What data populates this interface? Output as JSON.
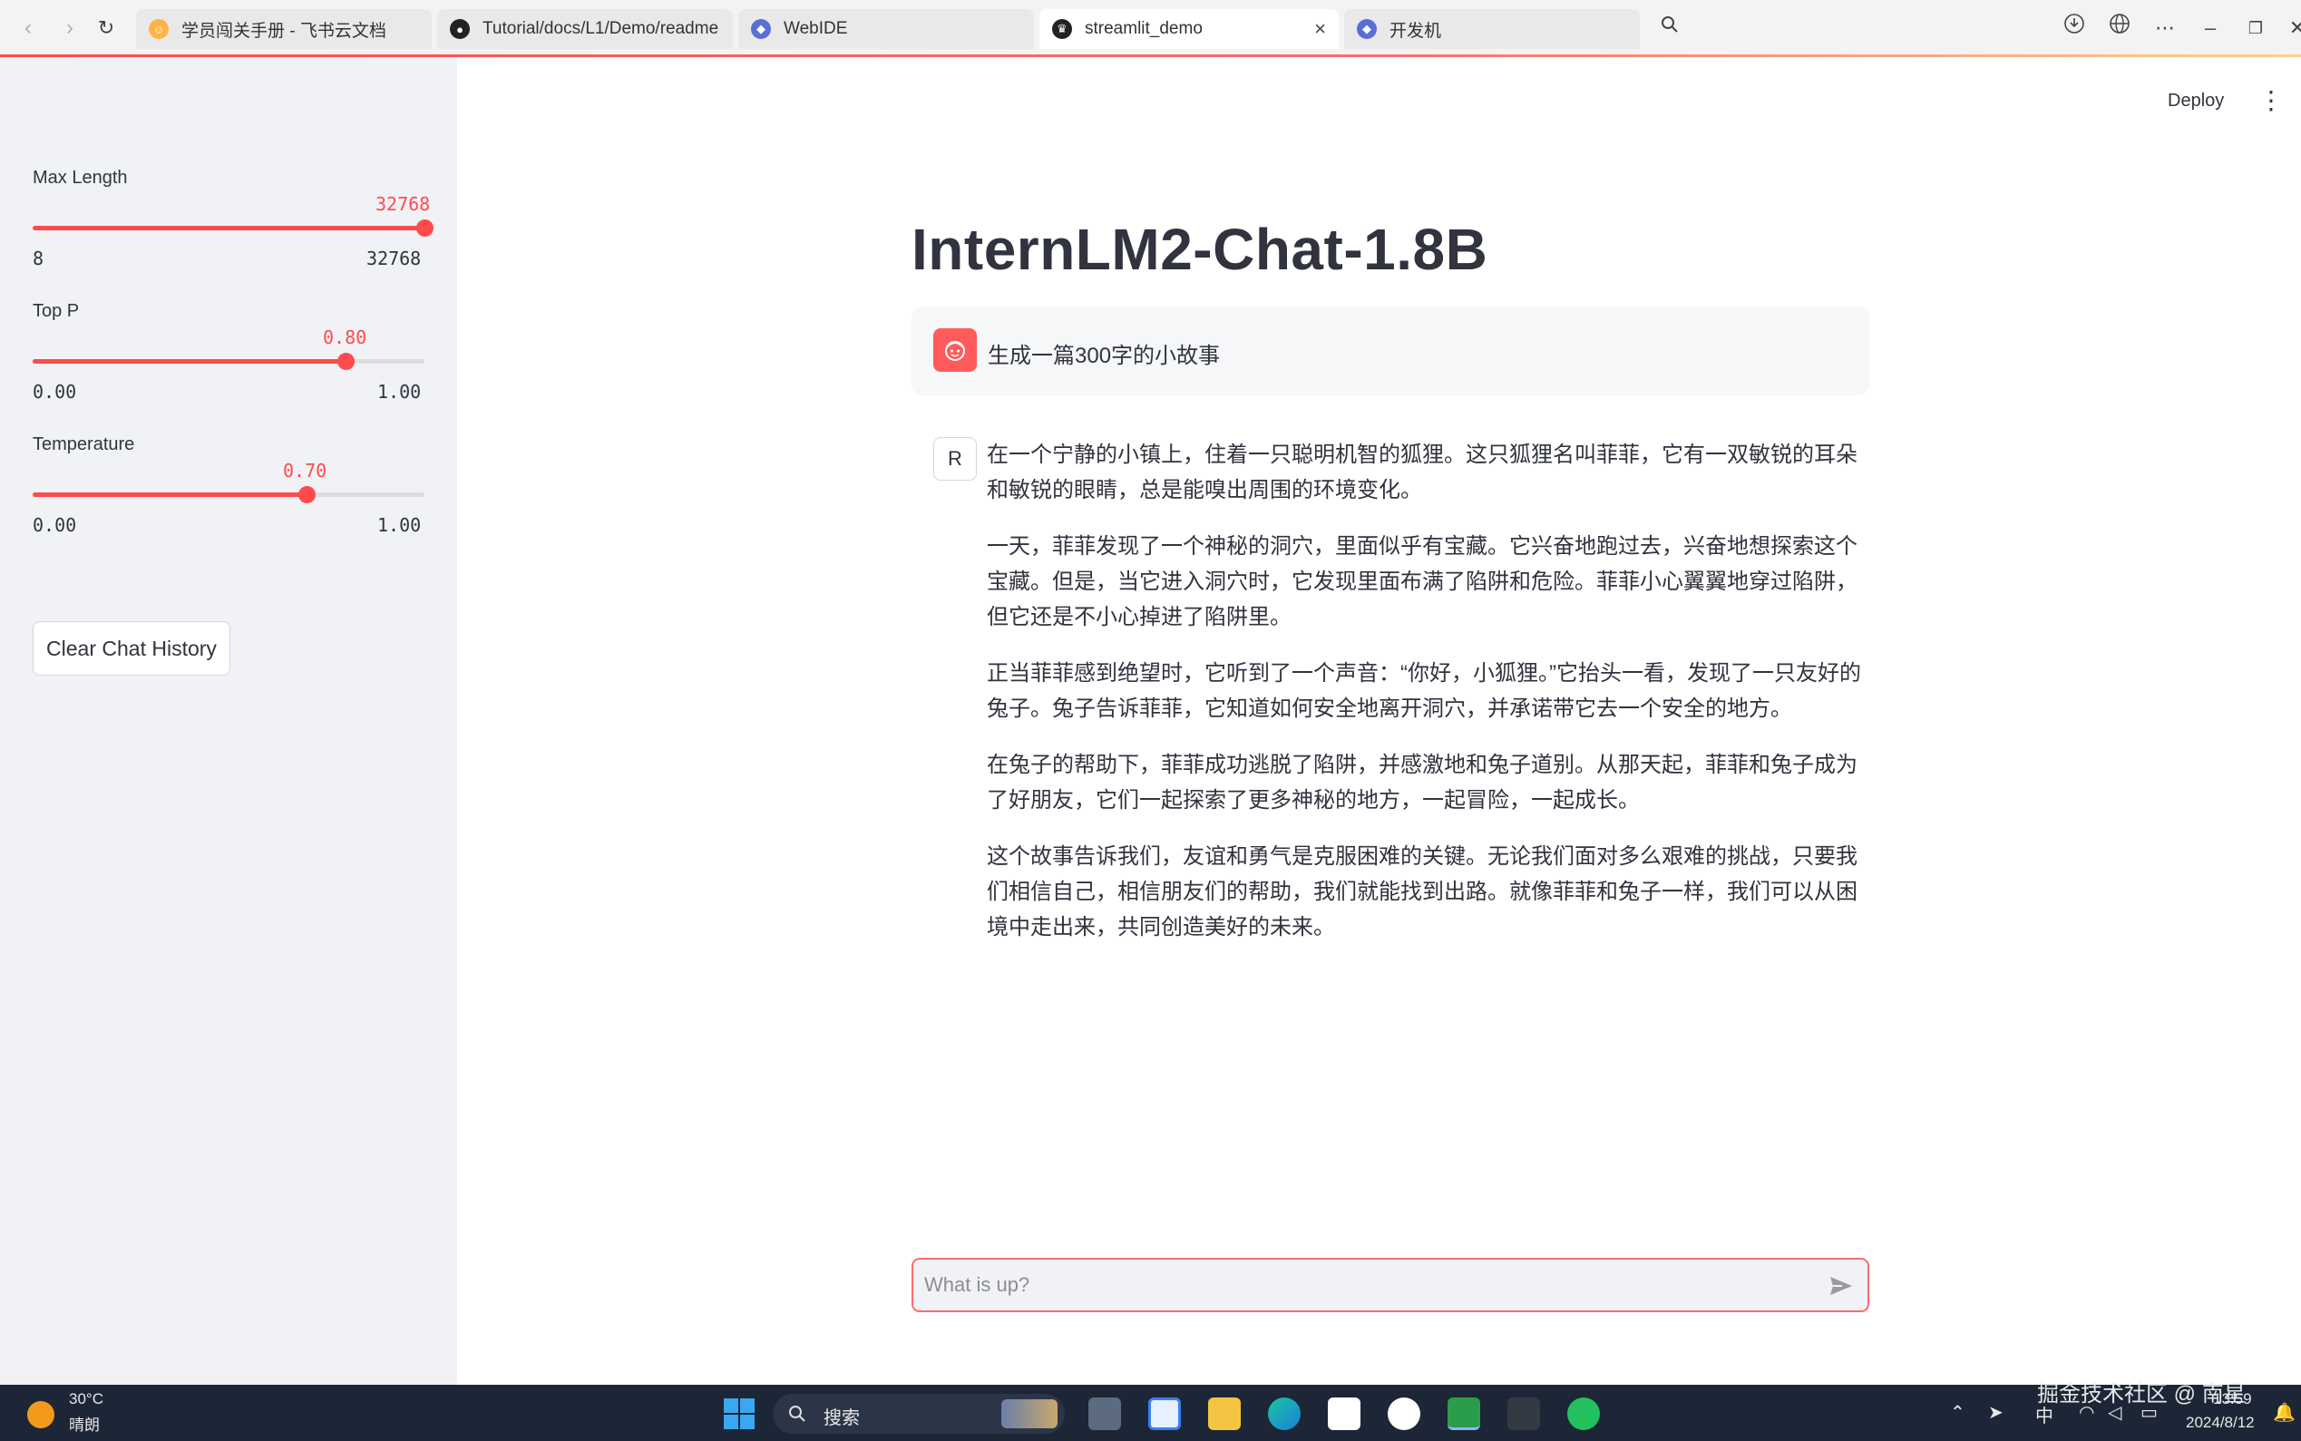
{
  "browser": {
    "tabs": [
      {
        "label": "学员闯关手册 - 飞书云文档",
        "active": false
      },
      {
        "label": "Tutorial/docs/L1/Demo/readme",
        "active": false
      },
      {
        "label": "WebIDE",
        "active": false
      },
      {
        "label": "streamlit_demo",
        "active": true
      },
      {
        "label": "开发机",
        "active": false
      }
    ],
    "back_icon": "back-arrow-icon",
    "forward_icon": "forward-arrow-icon",
    "reload_icon": "reload-icon",
    "close_icon": "×"
  },
  "sidebar": {
    "max_length": {
      "label": "Max Length",
      "value": "32768",
      "min": "8",
      "max": "32768",
      "fraction": 1.0
    },
    "top_p": {
      "label": "Top P",
      "value": "0.80",
      "min": "0.00",
      "max": "1.00",
      "fraction": 0.8
    },
    "temperature": {
      "label": "Temperature",
      "value": "0.70",
      "min": "0.00",
      "max": "1.00",
      "fraction": 0.7
    },
    "clear_button": "Clear Chat History",
    "accent_color": "#ff4b4b"
  },
  "header": {
    "deploy": "Deploy",
    "menu_icon": "⋮"
  },
  "main": {
    "title": "InternLM2-Chat-1.8B",
    "user_avatar": "R",
    "user_message": "生成一篇300字的小故事",
    "assistant_paragraphs": [
      "在一个宁静的小镇上，住着一只聪明机智的狐狸。这只狐狸名叫菲菲，它有一双敏锐的耳朵和敏锐的眼睛，总是能嗅出周围的环境变化。",
      "一天，菲菲发现了一个神秘的洞穴，里面似乎有宝藏。它兴奋地跑过去，兴奋地想探索这个宝藏。但是，当它进入洞穴时，它发现里面布满了陷阱和危险。菲菲小心翼翼地穿过陷阱，但它还是不小心掉进了陷阱里。",
      "正当菲菲感到绝望时，它听到了一个声音：“你好，小狐狸。”它抬头一看，发现了一只友好的兔子。兔子告诉菲菲，它知道如何安全地离开洞穴，并承诺带它去一个安全的地方。",
      "在兔子的帮助下，菲菲成功逃脱了陷阱，并感激地和兔子道别。从那天起，菲菲和兔子成为了好朋友，它们一起探索了更多神秘的地方，一起冒险，一起成长。",
      "这个故事告诉我们，友谊和勇气是克服困难的关键。无论我们面对多么艰难的挑战，只要我们相信自己，相信朋友们的帮助，我们就能找到出路。就像菲菲和兔子一样，我们可以从困境中走出来，共同创造美好的未来。"
    ],
    "chat_placeholder": "What is up?"
  },
  "taskbar": {
    "weather_temp": "30°C",
    "weather_desc": "晴朗",
    "search_label": "搜索",
    "ime": "中",
    "time": "13:59",
    "date": "2024/8/12",
    "watermark": "掘金技术社区 @ 南星"
  }
}
